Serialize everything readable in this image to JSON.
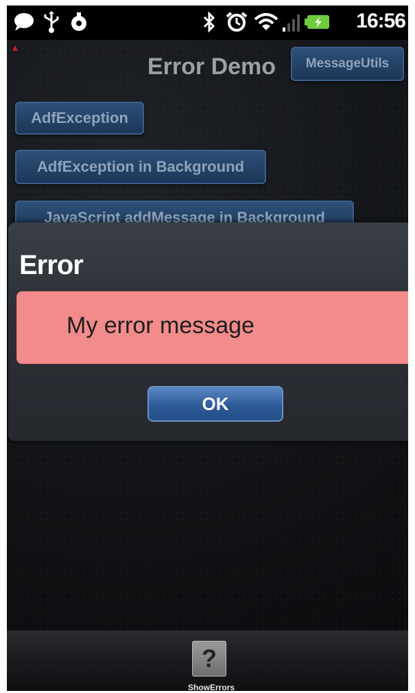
{
  "status_bar": {
    "time": "16:56",
    "icons": [
      "chat-bubble-icon",
      "usb-icon",
      "android-debug-icon",
      "bluetooth-icon",
      "alarm-icon",
      "wifi-icon",
      "signal-icon",
      "battery-icon"
    ]
  },
  "app": {
    "title": "Error Demo",
    "message_utils_label": "MessageUtils",
    "buttons": [
      {
        "label": "AdfException"
      },
      {
        "label": "AdfException in Background"
      },
      {
        "label": "JavaScript addMessage in Background"
      }
    ]
  },
  "dialog": {
    "title": "Error",
    "message": "My error message",
    "ok_label": "OK"
  },
  "bottom_bar": {
    "help_symbol": "?",
    "help_label": "ShowErrors"
  },
  "colors": {
    "error_box": "#f28b8b",
    "button_blue": "#2e4f78",
    "ok_blue": "#3a6aab"
  }
}
